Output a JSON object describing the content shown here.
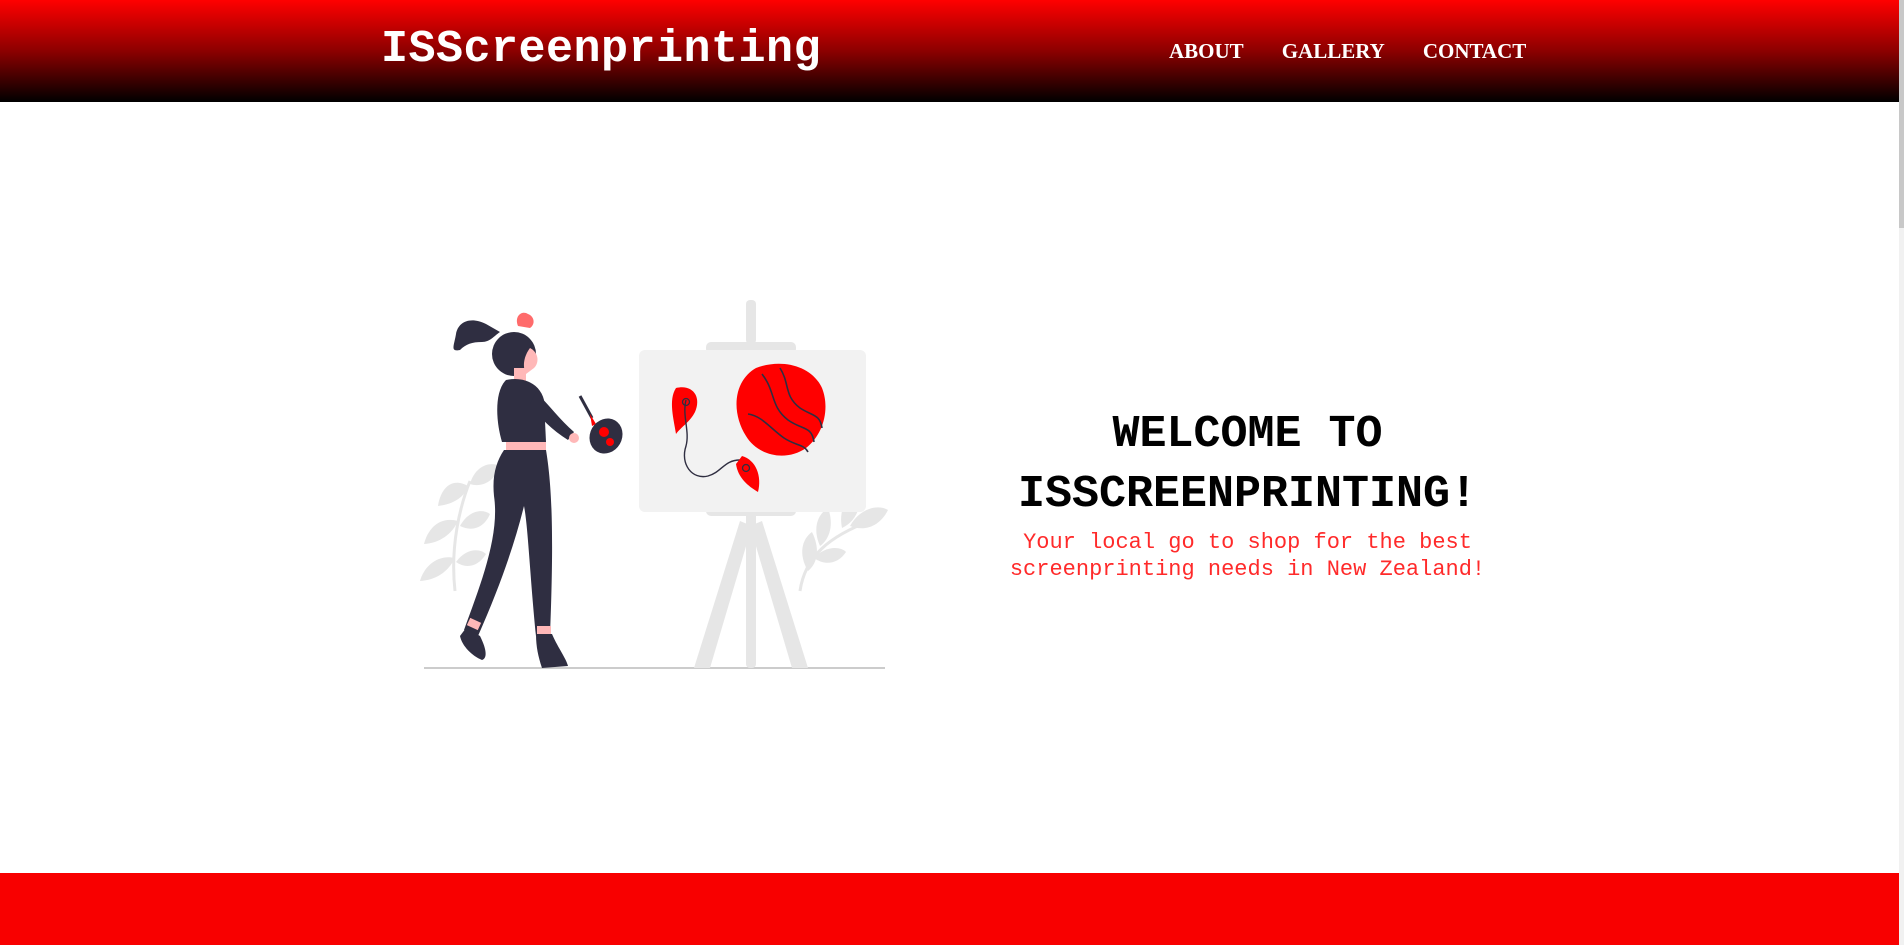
{
  "header": {
    "brand": "ISScreenprinting",
    "nav": [
      {
        "label": "ABOUT"
      },
      {
        "label": "GALLERY"
      },
      {
        "label": "CONTACT"
      }
    ]
  },
  "hero": {
    "title": "WELCOME TO ISSCREENPRINTING!",
    "subtitle": "Your local go to shop for the best screenprinting needs in New Zealand!",
    "illustration": "woman-painting-on-easel-illustration"
  },
  "colors": {
    "accent": "#ff0000",
    "footer": "#f80000",
    "subtitle": "#ff2a2a",
    "illustration_dark": "#2f2e41",
    "illustration_light": "#e6e6e6"
  }
}
